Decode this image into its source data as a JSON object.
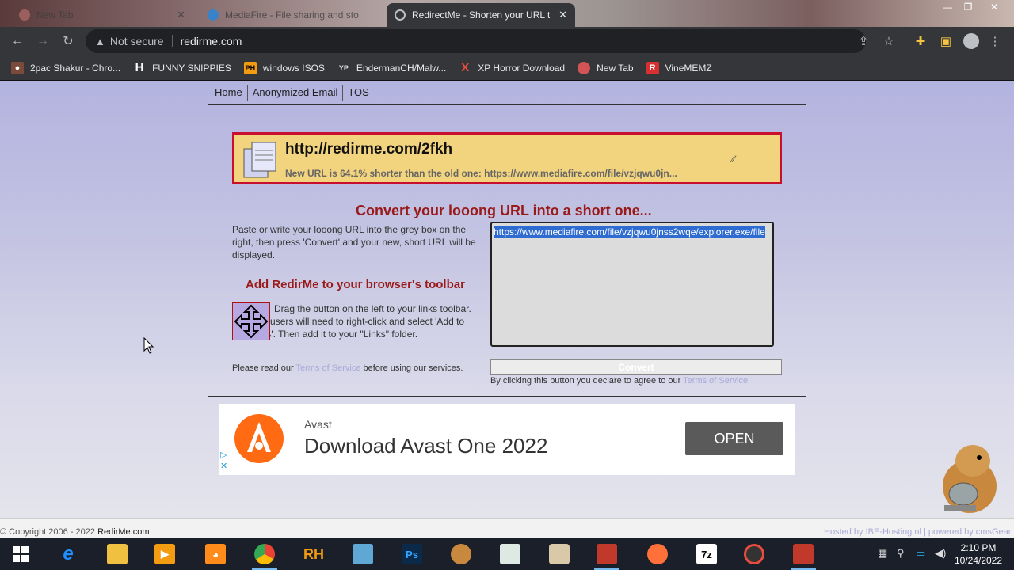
{
  "browser": {
    "tabs": [
      {
        "label": "New Tab",
        "active": false
      },
      {
        "label": "MediaFire - File sharing and sto",
        "active": false
      },
      {
        "label": "RedirectMe - Shorten your URL t",
        "active": true
      }
    ],
    "tab_close": "✕",
    "omnibox": {
      "security": "Not secure",
      "url": "redirme.com"
    },
    "bookmarks": [
      {
        "label": "2pac Shakur - Chro...",
        "icon": "tupac-avatar-icon",
        "color": "#c0392b"
      },
      {
        "label": "FUNNY SNIPPIES",
        "icon": "h-letter-icon",
        "color": "#ffffff"
      },
      {
        "label": "windows ISOS",
        "icon": "ph-icon",
        "color": "#f39c12"
      },
      {
        "label": "EndermanCH/Malw...",
        "icon": "yp-icon",
        "color": "#444444"
      },
      {
        "label": "XP Horror Download",
        "icon": "x-icon",
        "color": "#e74c3c"
      },
      {
        "label": "New Tab",
        "icon": "ball-icon",
        "color": "#d35454"
      },
      {
        "label": "VineMEMZ",
        "icon": "r-icon",
        "color": "#d63031"
      }
    ]
  },
  "site": {
    "nav": [
      "Home",
      "Anonymized Email",
      "TOS"
    ],
    "result": {
      "short_url": "http://redirme.com/2fkh",
      "info": "New URL is 64.1% shorter than the old one: https://www.mediafire.com/file/vzjqwu0jn..."
    },
    "heading": "Convert your looong URL into a short one...",
    "description": "Paste or write your looong URL into the grey box on the right, then press 'Convert' and your new, short URL will be displayed.",
    "toolbar_heading": "Add RedirMe to your browser's toolbar",
    "drag_text": "Drag the button on the left to your links toolbar. Explorer users will need to right-click and select 'Add to Favorites'. Then add it to your \"Links\" folder.",
    "long_url": "https://www.mediafire.com/file/vzjqwu0jnss2wqe/explorer.exe/file",
    "terms_prefix": "Please read our ",
    "terms_link": "Terms of Service",
    "terms_suffix": " before using our services.",
    "convert_label": "Convert",
    "agree_prefix": "By clicking this button you declare to agree to our ",
    "agree_link": "Terms of Service"
  },
  "ad": {
    "brand": "Avast",
    "headline": "Download Avast One 2022",
    "button": "OPEN"
  },
  "footer": {
    "copyright_prefix": "© Copyright 2006 - 2022 ",
    "copyright_site": "RedirMe.com",
    "hosted": "Hosted by IBE-Hosting.nl  |  powered by cmsGear"
  },
  "taskbar": {
    "time": "2:10 PM",
    "date": "10/24/2022",
    "apps": [
      "start",
      "internet-explorer",
      "file-explorer",
      "media-player",
      "uc-browser",
      "chrome",
      "rh",
      "photo-viewer",
      "photoshop",
      "hamster",
      "notepad",
      "vlc",
      "media",
      "firefox",
      "7z",
      "app",
      "app2"
    ]
  }
}
